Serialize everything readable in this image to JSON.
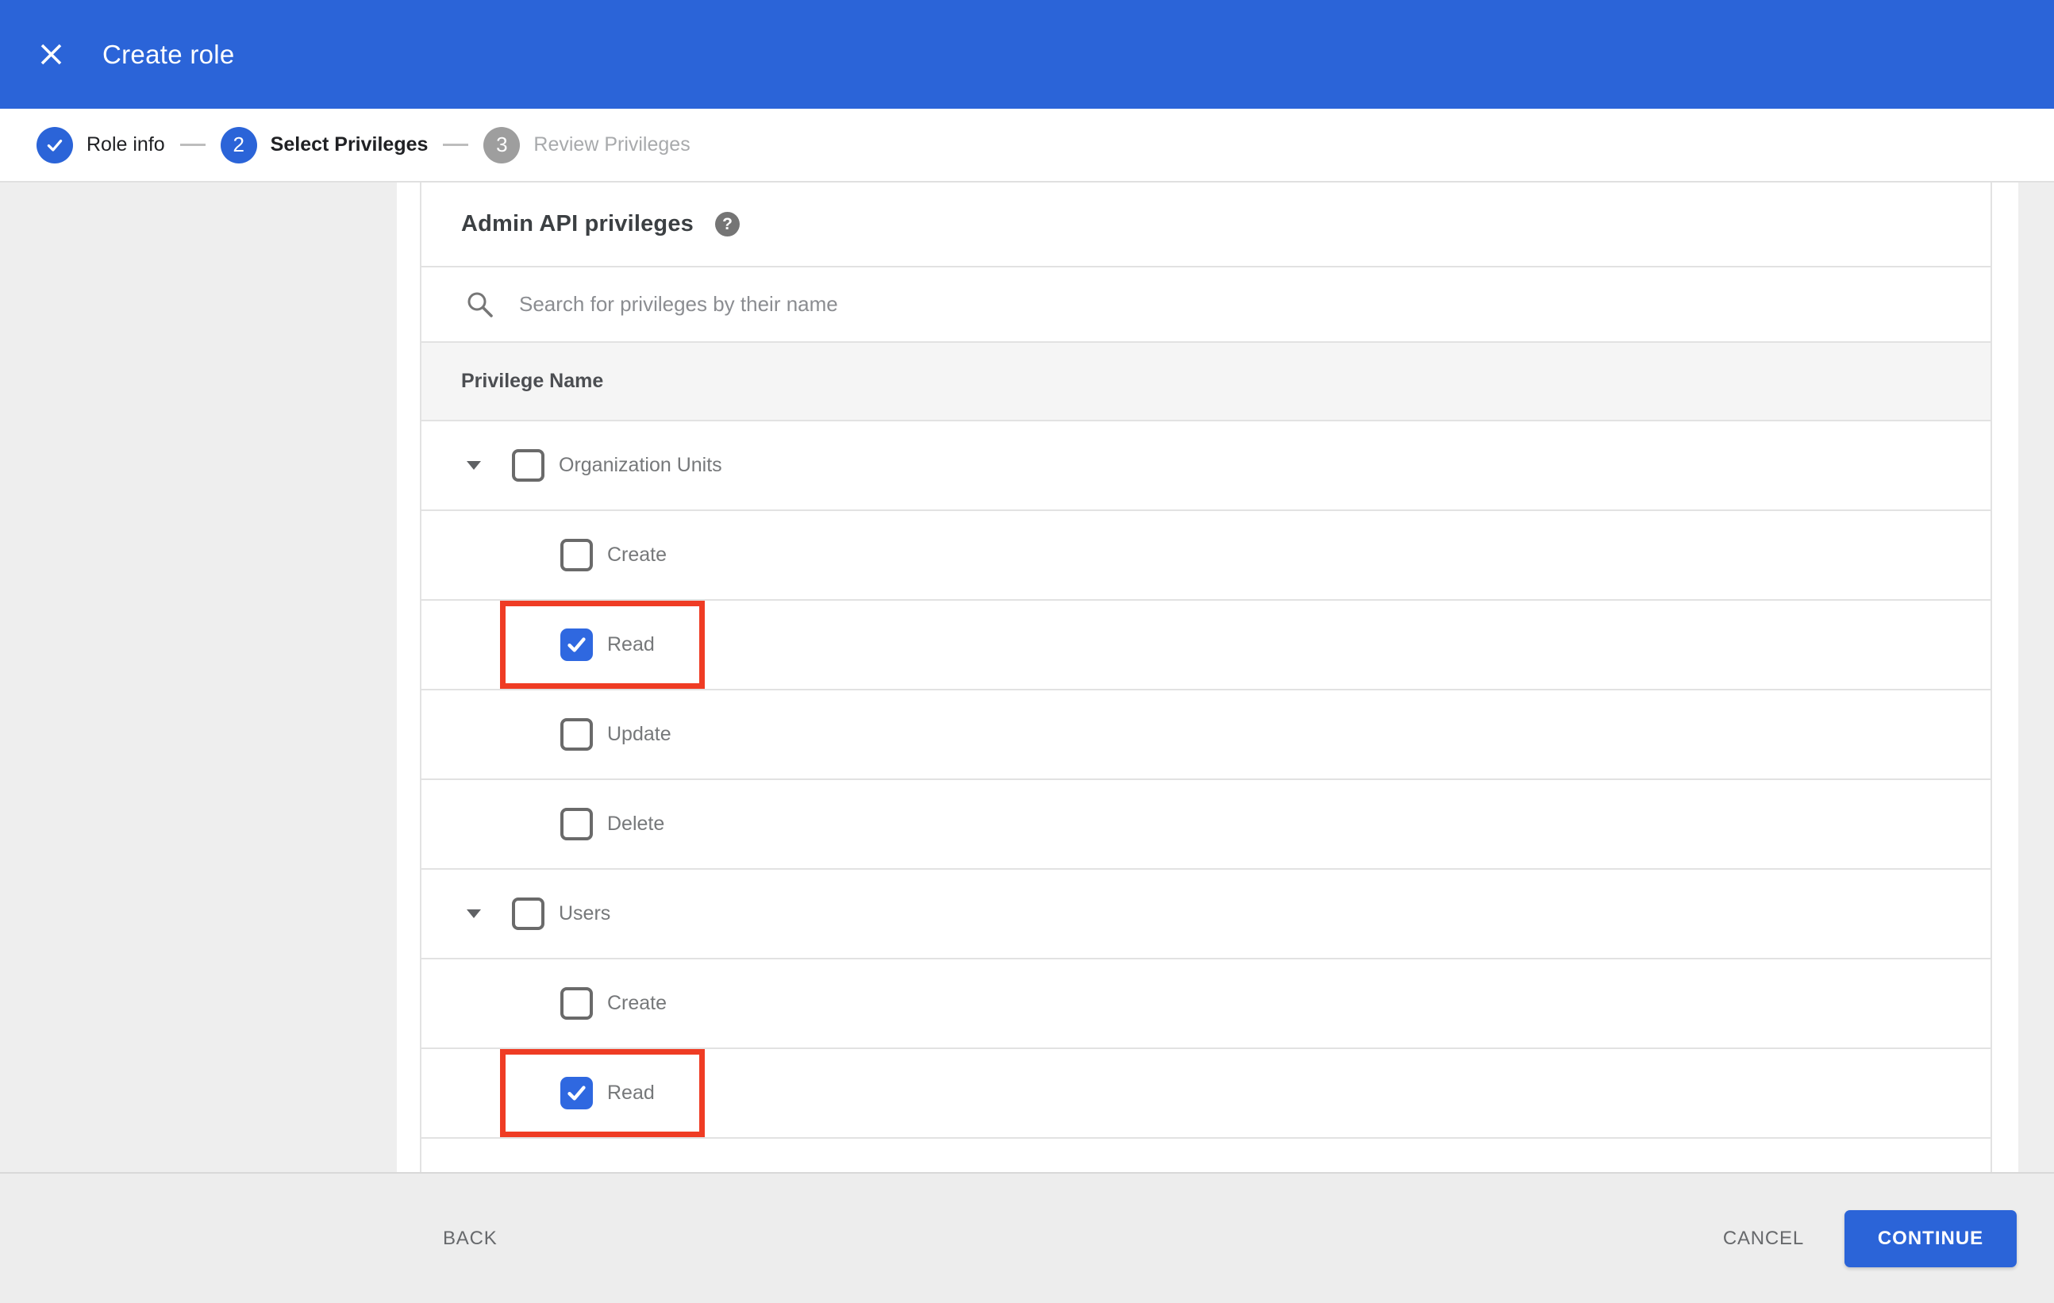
{
  "header": {
    "title": "Create role"
  },
  "stepper": {
    "steps": [
      {
        "label": "Role info",
        "state": "completed",
        "marker": "check"
      },
      {
        "label": "Select Privileges",
        "state": "active",
        "marker": "2"
      },
      {
        "label": "Review Privileges",
        "state": "upcoming",
        "marker": "3"
      }
    ]
  },
  "panel": {
    "heading": "Admin API privileges",
    "help_icon": "?",
    "search": {
      "placeholder": "Search for privileges by their name",
      "value": ""
    },
    "table": {
      "column_header": "Privilege Name",
      "rows": [
        {
          "type": "parent",
          "label": "Organization Units",
          "checked": false,
          "expanded": true,
          "highlight": false
        },
        {
          "type": "child",
          "label": "Create",
          "checked": false,
          "highlight": false
        },
        {
          "type": "child",
          "label": "Read",
          "checked": true,
          "highlight": true
        },
        {
          "type": "child",
          "label": "Update",
          "checked": false,
          "highlight": false
        },
        {
          "type": "child",
          "label": "Delete",
          "checked": false,
          "highlight": false
        },
        {
          "type": "parent",
          "label": "Users",
          "checked": false,
          "expanded": true,
          "highlight": false
        },
        {
          "type": "child",
          "label": "Create",
          "checked": false,
          "highlight": false
        },
        {
          "type": "child",
          "label": "Read",
          "checked": true,
          "highlight": true
        }
      ]
    }
  },
  "footer": {
    "back_label": "BACK",
    "cancel_label": "CANCEL",
    "continue_label": "CONTINUE"
  },
  "colors": {
    "header_blue": "#2b64d8",
    "accent_blue": "#2f68e0",
    "button_blue": "#2b64d8",
    "inactive_gray": "#9e9e9e",
    "highlight_red": "#ef3c24"
  }
}
